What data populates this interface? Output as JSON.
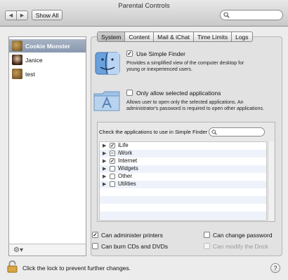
{
  "window": {
    "title": "Parental Controls"
  },
  "toolbar": {
    "back_icon": "back-arrow-icon",
    "forward_icon": "forward-arrow-icon",
    "show_all_label": "Show All",
    "search_placeholder": ""
  },
  "users": [
    {
      "name": "Cookie Monster",
      "selected": true
    },
    {
      "name": "Janice",
      "selected": false
    },
    {
      "name": "test",
      "selected": false
    }
  ],
  "tabs": [
    "System",
    "Content",
    "Mail & iChat",
    "Time Limits",
    "Logs"
  ],
  "system": {
    "simple_finder": {
      "label": "Use Simple Finder",
      "checked": true,
      "description": [
        "Provides a simplified view of the computer desktop for",
        "young or inexperienced users."
      ]
    },
    "only_selected_apps": {
      "label": "Only allow selected applications",
      "checked": false,
      "description": [
        "Allows user to open only the selected applications. An",
        "administrator's password is required to open other applications."
      ]
    },
    "apps": {
      "header": "Check the applications to use in Simple Finder",
      "items": [
        {
          "name": "iLife",
          "state": "checked"
        },
        {
          "name": "iWork",
          "state": "mixed"
        },
        {
          "name": "Internet",
          "state": "checked"
        },
        {
          "name": "Widgets",
          "state": "unchecked"
        },
        {
          "name": "Other",
          "state": "unchecked"
        },
        {
          "name": "Utilities",
          "state": "unchecked"
        }
      ]
    },
    "options": {
      "administer_printers": {
        "label": "Can administer printers",
        "checked": true
      },
      "change_password": {
        "label": "Can change password",
        "checked": false
      },
      "burn_cds": {
        "label": "Can burn CDs and DVDs",
        "checked": false
      },
      "modify_dock": {
        "label": "Can modify the Dock",
        "checked": false,
        "disabled": true
      }
    }
  },
  "footer": {
    "lock_text": "Click the lock to prevent further changes.",
    "help_label": "?"
  },
  "colors": {
    "selection": "#8898af",
    "window_bg": "#ececec"
  }
}
